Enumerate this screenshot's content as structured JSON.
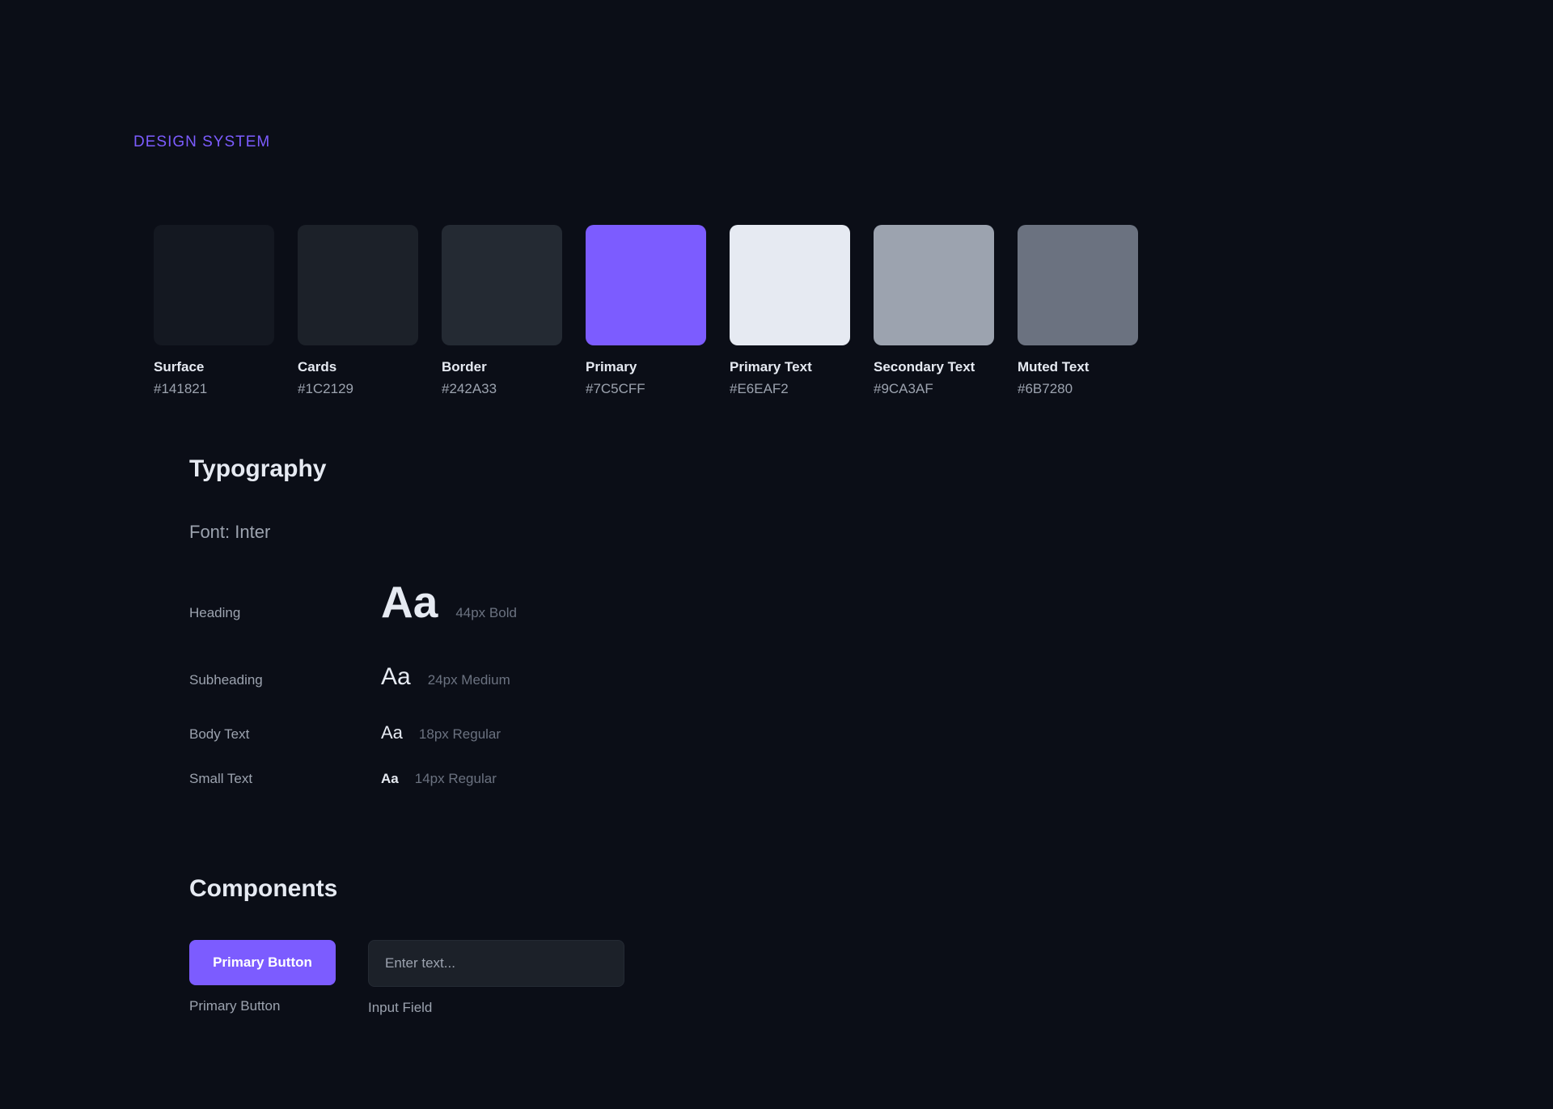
{
  "header": {
    "eyebrow": "DESIGN SYSTEM"
  },
  "colors": {
    "items": [
      {
        "name": "Surface",
        "hex": "#141821"
      },
      {
        "name": "Cards",
        "hex": "#1C2129"
      },
      {
        "name": "Border",
        "hex": "#242A33"
      },
      {
        "name": "Primary",
        "hex": "#7C5CFF"
      },
      {
        "name": "Primary Text",
        "hex": "#E6EAF2"
      },
      {
        "name": "Secondary Text",
        "hex": "#9CA3AF"
      },
      {
        "name": "Muted Text",
        "hex": "#6B7280"
      }
    ]
  },
  "typography": {
    "title": "Typography",
    "font_line": "Font: Inter",
    "rows": [
      {
        "label": "Heading",
        "sample": "Aa",
        "meta": "44px Bold"
      },
      {
        "label": "Subheading",
        "sample": "Aa",
        "meta": "24px Medium"
      },
      {
        "label": "Body Text",
        "sample": "Aa",
        "meta": "18px Regular"
      },
      {
        "label": "Small Text",
        "sample": "Aa",
        "meta": "14px Regular"
      }
    ]
  },
  "components": {
    "title": "Components",
    "primary_button_label": "Primary Button",
    "primary_button_caption": "Primary Button",
    "input_placeholder": "Enter text...",
    "input_value": "",
    "input_caption": "Input Field"
  }
}
